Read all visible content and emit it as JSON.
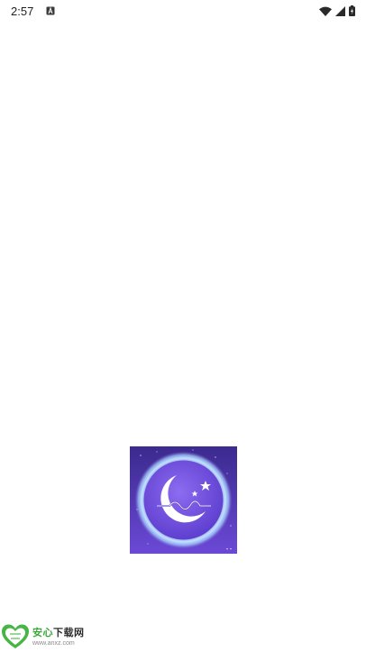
{
  "status_bar": {
    "time": "2:57",
    "icons": [
      "notification-a-icon",
      "wifi-icon",
      "signal-icon",
      "battery-charging-icon"
    ]
  },
  "splash": {
    "logo": "moon-stars-wave-logo",
    "colors": {
      "bg_top": "#3a2a8f",
      "bg_bottom": "#6a48d6",
      "glow": "#bfe0ff",
      "moon": "#ffffff"
    }
  },
  "watermark": {
    "brand_cn_green": "安心",
    "brand_cn_rest": "下载网",
    "url": "www.anxz.com",
    "colors": {
      "green": "#3aa63a",
      "dark": "#2f2f2f"
    }
  }
}
